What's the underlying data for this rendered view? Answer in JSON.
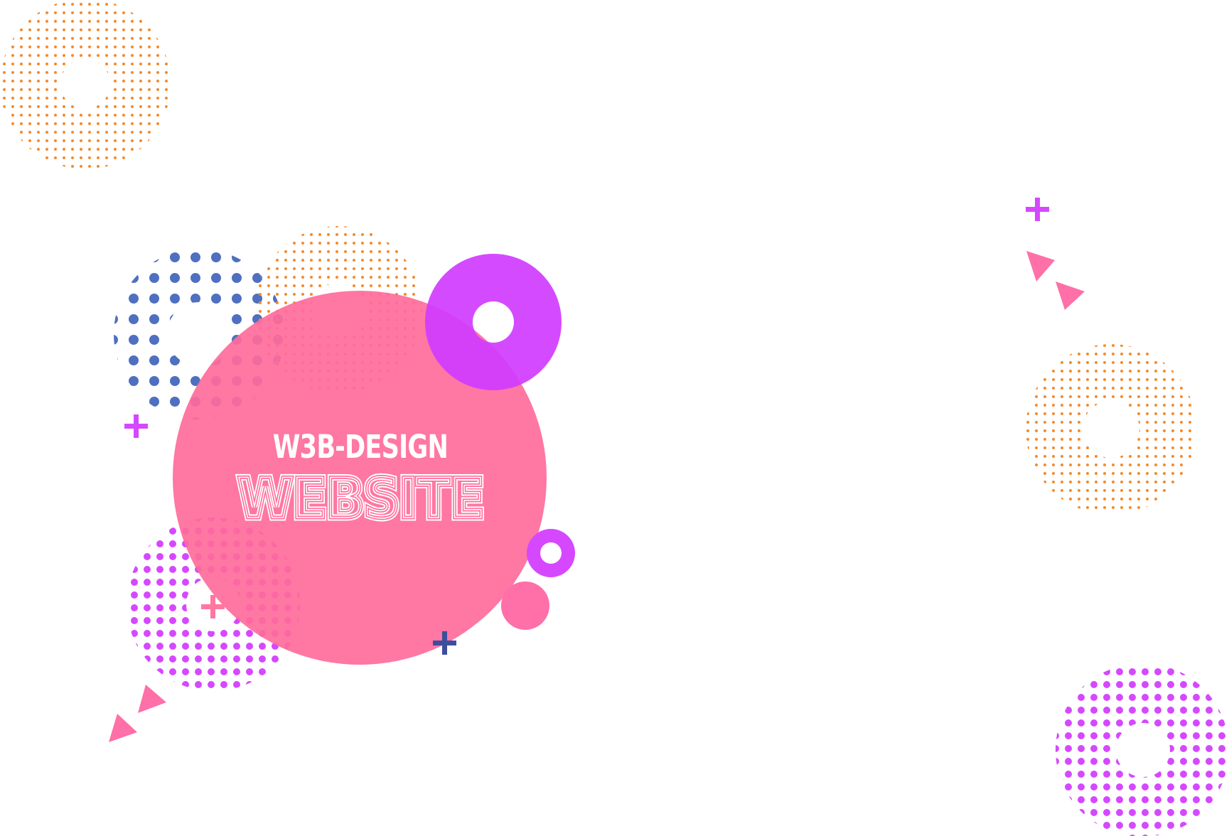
{
  "hero": {
    "brand": "W3B-DESIGN",
    "headline": "WEBSITE"
  },
  "colors": {
    "background": "#ffffff",
    "pink": "#ff78a0",
    "pink_solid": "#ff74a6",
    "magenta": "#d548ff",
    "orange": "#f58a2a",
    "blue": "#4f70c0",
    "navy_plus": "#3d4f9c",
    "white": "#ffffff"
  },
  "icons": [
    "dotted-ring",
    "ring",
    "plus",
    "triangle",
    "circle"
  ]
}
